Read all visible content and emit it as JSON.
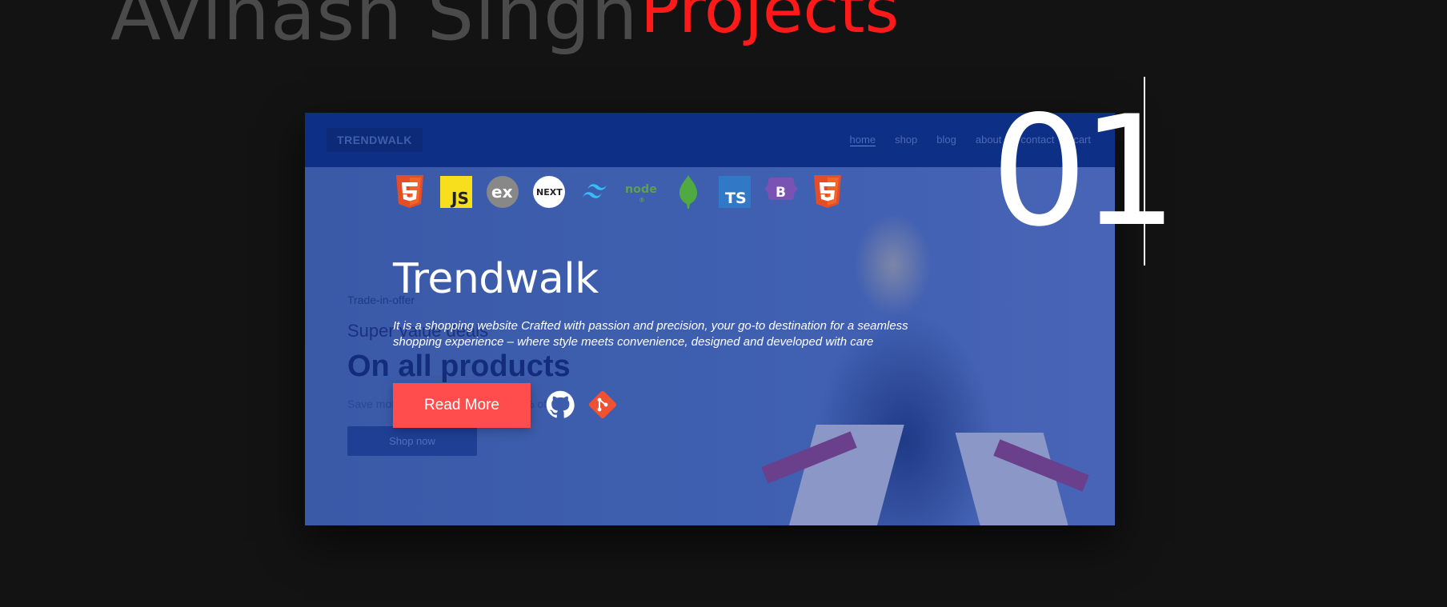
{
  "header": {
    "name": "Avinash Singh",
    "section": "Projects"
  },
  "project": {
    "number": "01",
    "title": "Trendwalk",
    "description": "It is a shopping website Crafted with passion and precision, your go-to destination for a seamless shopping experience – where style meets convenience, designed and developed with care",
    "read_more_label": "Read More",
    "tech_icons": [
      "html5-icon",
      "javascript-icon",
      "express-icon",
      "nextjs-icon",
      "tailwind-icon",
      "nodejs-icon",
      "mongodb-icon",
      "typescript-icon",
      "bootstrap-icon",
      "html5-icon"
    ],
    "links": [
      "github-icon",
      "git-icon"
    ]
  },
  "preview": {
    "logo": "TRENDWALK",
    "nav": [
      "home",
      "shop",
      "blog",
      "about",
      "contact",
      "cart"
    ],
    "offer": "Trade-in-offer",
    "super": "Super value deals",
    "headline": "On all products",
    "save": "Save more with coupons & up to 70% off!",
    "shop_button": "Shop now"
  },
  "colors": {
    "accent": "#ff1a1a",
    "button": "#ff4d4d",
    "overlay": "#3f5fb0",
    "background": "#131313"
  }
}
